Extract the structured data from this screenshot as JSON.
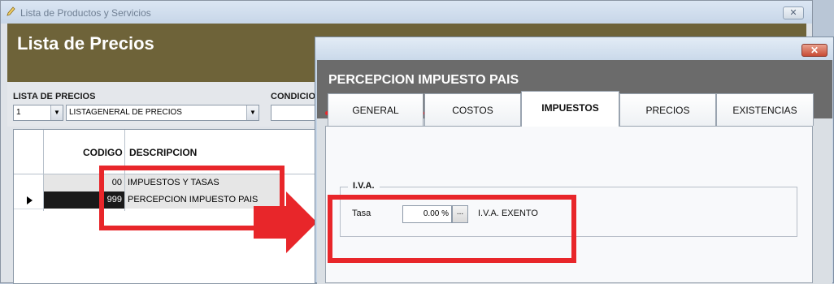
{
  "main_window": {
    "title": "Lista de Productos y Servicios",
    "close_label": "✕"
  },
  "header": {
    "title": "Lista de Precios"
  },
  "filters": {
    "list_label": "LISTA DE PRECIOS",
    "list_number": "1",
    "list_name": "LISTAGENERAL DE PRECIOS",
    "cond_label": "CONDICIO"
  },
  "grid": {
    "columns": [
      "CODIGO",
      "DESCRIPCION"
    ],
    "rows": [
      {
        "code": "00",
        "description": "IMPUESTOS Y TASAS",
        "selected": false
      },
      {
        "code": "999",
        "description": "PERCEPCION IMPUESTO PAIS",
        "selected": true
      }
    ]
  },
  "dialog": {
    "close_label": "✕",
    "heading": "PERCEPCION IMPUESTO PAIS",
    "tabs": [
      "GENERAL",
      "COSTOS",
      "IMPUESTOS",
      "PRECIOS",
      "EXISTENCIAS"
    ],
    "active_tab": "IMPUESTOS",
    "iva": {
      "legend": "I.V.A.",
      "rate_label": "Tasa",
      "rate_value": "0.00 %",
      "picker_label": "...",
      "category": "I.V.A. EXENTO"
    }
  },
  "colors": {
    "annotation": "#e8262a",
    "header_bg": "#6e6339",
    "dialog_header_bg": "#6b6b6b"
  }
}
